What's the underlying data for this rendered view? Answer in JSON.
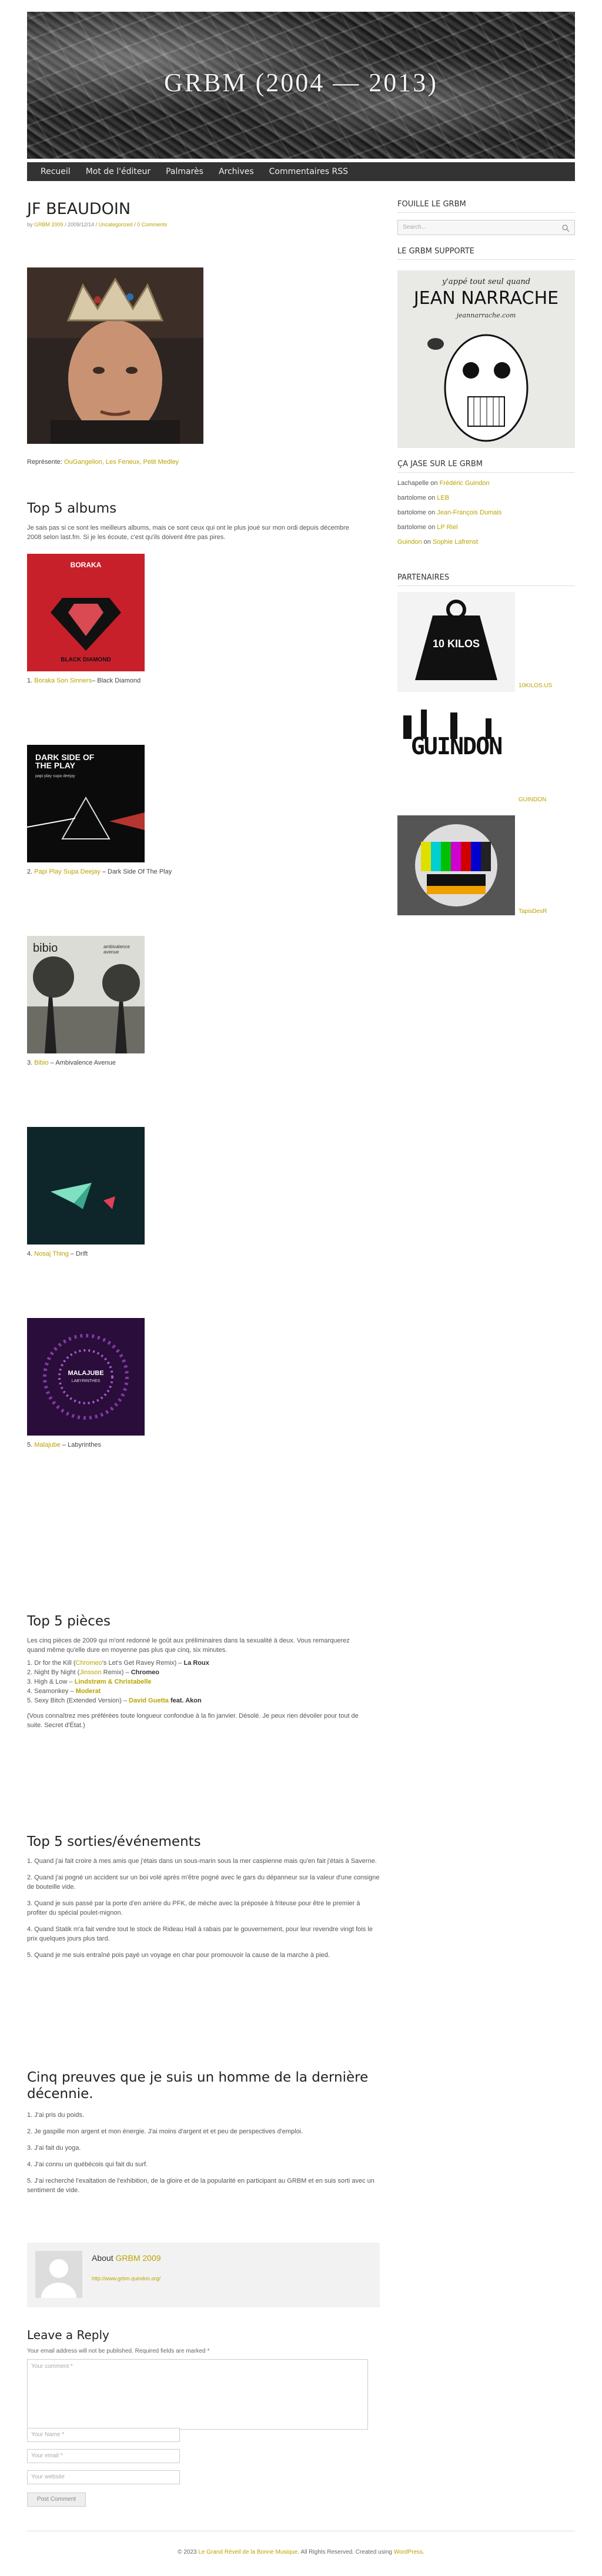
{
  "site": {
    "title": "GRBM (2004 — 2013)",
    "nav": [
      "Recueil",
      "Mot de l'éditeur",
      "Palmarès",
      "Archives",
      "Commentaires RSS"
    ]
  },
  "post": {
    "title": "JF BEAUDOIN",
    "meta_by": "by",
    "meta_author": "GRBM 2009",
    "meta_date": "/ 2009/12/14 /",
    "meta_category": "Uncategorized",
    "meta_sep": "/",
    "meta_comments": "0 Comments",
    "represente_label": "Représente:",
    "represente_links": "OuGangelion, Les Feneux, Petit Medley",
    "top5_albums_title": "Top 5 albums",
    "top5_albums_intro": "Je sais pas si ce sont les meilleurs albums, mais ce sont ceux qui ont le plus joué sur mon ordi depuis décembre 2008 selon last.fm.   Si je les écoute, c'est qu'ils doivent être pas pires.",
    "albums": [
      {
        "num": "1.",
        "artist": "Boraka Son Sinners",
        "sep": "– ",
        "title": "Black Diamond",
        "cover_text": "BORAKA",
        "cover_sub": "BLACK DIAMOND"
      },
      {
        "num": "2.",
        "artist": "Papi Play Supa Deejay",
        "sep": " – ",
        "title": "Dark Side Of The Play",
        "cover_text": "DARK SIDE OF THE PLAY",
        "cover_sub": "papi play supa deejay"
      },
      {
        "num": "3.",
        "artist": "Bibio",
        "sep": " – ",
        "title": "Ambivalence Avenue",
        "cover_text": "bibio",
        "cover_sub": "ambivalence avenue"
      },
      {
        "num": "4.",
        "artist": "Nosaj Thing",
        "sep": " – ",
        "title": "Drift",
        "cover_text": "",
        "cover_sub": ""
      },
      {
        "num": "5.",
        "artist": "Malajube",
        "sep": " – ",
        "title": "Labyrinthes",
        "cover_text": "MALAJUBE",
        "cover_sub": "LABYRINTHES"
      }
    ],
    "top5_pieces_title": "Top 5 pièces",
    "top5_pieces_intro": "Les cinq pièces de 2009 qui m'ont redonné le goût aux préliminaires dans la sexualité à deux.  Vous remarquerez quand même qu'elle dure en moyenne pas plus que cinq, six minutes.",
    "pieces": [
      {
        "pre": "1. Dr for the Kill (",
        "link": "Chromeo",
        "mid": "'s Let's Get Ravey Remix) – ",
        "bold": "La Roux"
      },
      {
        "pre": "2. Night By Night (",
        "link": "Jinsson",
        "mid": " Remix) – ",
        "bold": "Chromeo"
      },
      {
        "pre": "3. High & Low – ",
        "link": "Lindstrøm & Christabelle",
        "mid": "",
        "bold": ""
      },
      {
        "pre": "4. Seamonkey – ",
        "link": "Moderat",
        "mid": "",
        "bold": ""
      },
      {
        "pre": "5. Sexy Bitch (Extended Version) – ",
        "link": "David Guetta",
        "mid": " feat. ",
        "bold": "Akon"
      }
    ],
    "pieces_outro": "(Vous connaîtrez mes préférées toute longueur confondue à la fin janvier. Désolé. Je peux rien dévoiler pour tout de suite.  Secret d'État.)",
    "top5_sorties_title": "Top 5 sorties/événements",
    "sorties": [
      "1. Quand j'ai fait croire à mes amis que j'étais dans un sous-marin sous la mer caspienne mais qu'en fait j'étais à Saverne.",
      "2. Quand j'ai pogné un accident sur un boi volé après m'être pogné avec le gars du dépanneur sur la valeur d'une consigne de bouteille vide.",
      "3. Quand je suis passé par la porte d'en arrière du PFK, de mèche avec la préposée à friteuse pour être le premier à profiter du spécial poulet-mignon.",
      "4. Quand Statik m'a fait vendre tout le stock de Rideau Hall à rabais par le gouvernement, pour leur revendre vingt fois le prix quelques jours plus tard.",
      "5. Quand je me suis entraîné pois payé un voyage en char pour promouvoir la cause de la marche à pied."
    ],
    "cinq_title": "Cinq preuves que je suis un homme de la dernière décennie.",
    "cinq": [
      "1. J'ai pris du poids.",
      "2. Je gaspille mon argent et mon énergie. J'ai moins d'argent et et peu de perspectives d'emploi.",
      "3. J'ai fait du yoga.",
      "4. J'ai connu un québécois qui fait du surf.",
      "5. J'ai recherché l'exaltation de l'exhibition, de la gloire et de la popularité en participant au GRBM et en suis sorti avec un sentiment de vide."
    ],
    "about_label": "About",
    "about_name": "GRBM 2009",
    "about_url": "http://www.grbm.quindon.org/",
    "reply_title": "Leave a Reply",
    "reply_note": "Your email address will not be published. Required fields are marked *",
    "comment_placeholder": "Your comment *",
    "name_placeholder": "Your Name *",
    "email_placeholder": "Your email *",
    "website_placeholder": "Your website",
    "submit_label": "Post Comment"
  },
  "sidebar": {
    "fouille_title": "FOUILLE LE GRBM",
    "search_placeholder": "Search...",
    "supporte_title": "LE GRBM SUPPORTE",
    "poster_line1": "y'appé tout seul quand",
    "poster_line2": "JEAN NARRACHE",
    "poster_line3": "jeannarrache.com",
    "jase_title": "ÇA JASE SUR LE GRBM",
    "jase": [
      {
        "who": "Lachapelle",
        "on": " on ",
        "post": "Frédéric Guindon"
      },
      {
        "who": "bartolome",
        "on": " on ",
        "post": "LEB"
      },
      {
        "who": "bartolome",
        "on": " on ",
        "post": "Jean-François Dumais"
      },
      {
        "who": "bartolome",
        "on": " on ",
        "post": "LP Riel"
      },
      {
        "who": "Guindon",
        "on": " on ",
        "post": "Sophie Lafrenst"
      }
    ],
    "partenaires_title": "PARTENAIRES",
    "partners": [
      {
        "label": "10KILOS.US",
        "art": "10 KILOS"
      },
      {
        "label": "GUINDON",
        "art": "GUINDON"
      },
      {
        "label": "TapisDesR",
        "art": ""
      }
    ]
  },
  "footer": {
    "text_pre": "© 2023 ",
    "text_link": "Le Grand Réveil de la Bonne Musique",
    "text_mid": ". All Rights Reserved. Created using ",
    "text_link2": "WordPress",
    "text_end": "."
  },
  "colors": {
    "accent": "#b9a300",
    "nav_bg": "#333333"
  }
}
